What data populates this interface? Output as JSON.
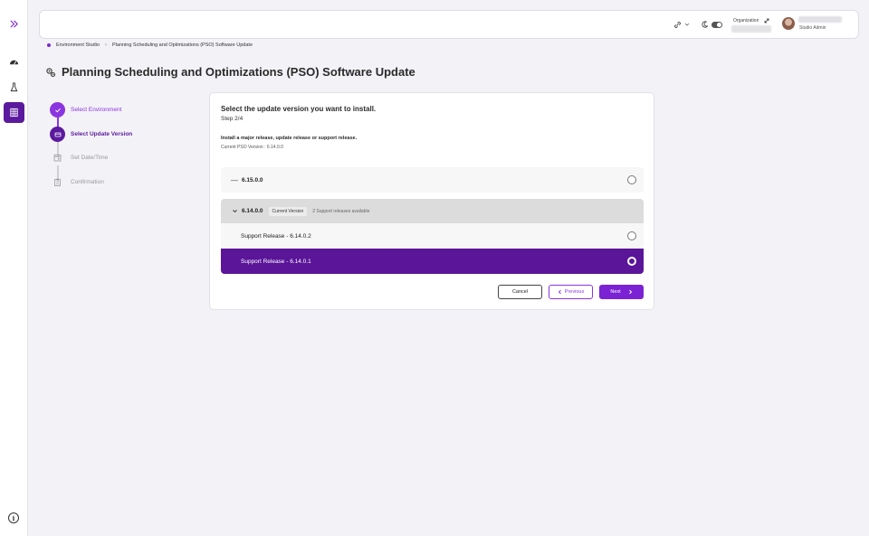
{
  "rail": {
    "items": [
      {
        "icon": "expand-chevrons-icon"
      },
      {
        "icon": "speed-gauge-icon"
      },
      {
        "icon": "flask-icon"
      },
      {
        "icon": "grid-table-icon",
        "active": true
      }
    ],
    "info_icon": "info-icon"
  },
  "topbar": {
    "org_label": "Organization",
    "user_role": "Studio Admin"
  },
  "breadcrumb": {
    "items": [
      "Environment Studio",
      "Planning Scheduling and Optimizations (PSO) Software Update"
    ]
  },
  "page": {
    "title": "Planning Scheduling and Optimizations (PSO) Software Update"
  },
  "stepper": {
    "steps": [
      {
        "label": "Select Environment",
        "state": "done"
      },
      {
        "label": "Select Update Version",
        "state": "current"
      },
      {
        "label": "Set Date/Time",
        "state": "pending"
      },
      {
        "label": "Confirmation",
        "state": "pending"
      }
    ]
  },
  "card": {
    "title": "Select the update version you want to install.",
    "step": "Step 2/4",
    "description": "Install a major release, update release or support release.",
    "current_version": "Current PSO Version : 6.14.0.0",
    "versions": {
      "v1": {
        "label": "6.15.0.0",
        "expander": "—"
      },
      "v2": {
        "label": "6.14.0.0",
        "expander": "⌄",
        "badge": "Current Version",
        "support_note": "2 Support releases available"
      },
      "s1": {
        "label": "Support Release - 6.14.0.2"
      },
      "s2": {
        "label": "Support Release - 6.14.0.1"
      }
    },
    "buttons": {
      "cancel": "Cancel",
      "previous": "Previous",
      "next": "Next"
    }
  },
  "colors": {
    "accent": "#7a22d4",
    "accent_dark": "#5a1598",
    "background": "#f3f2f6"
  }
}
